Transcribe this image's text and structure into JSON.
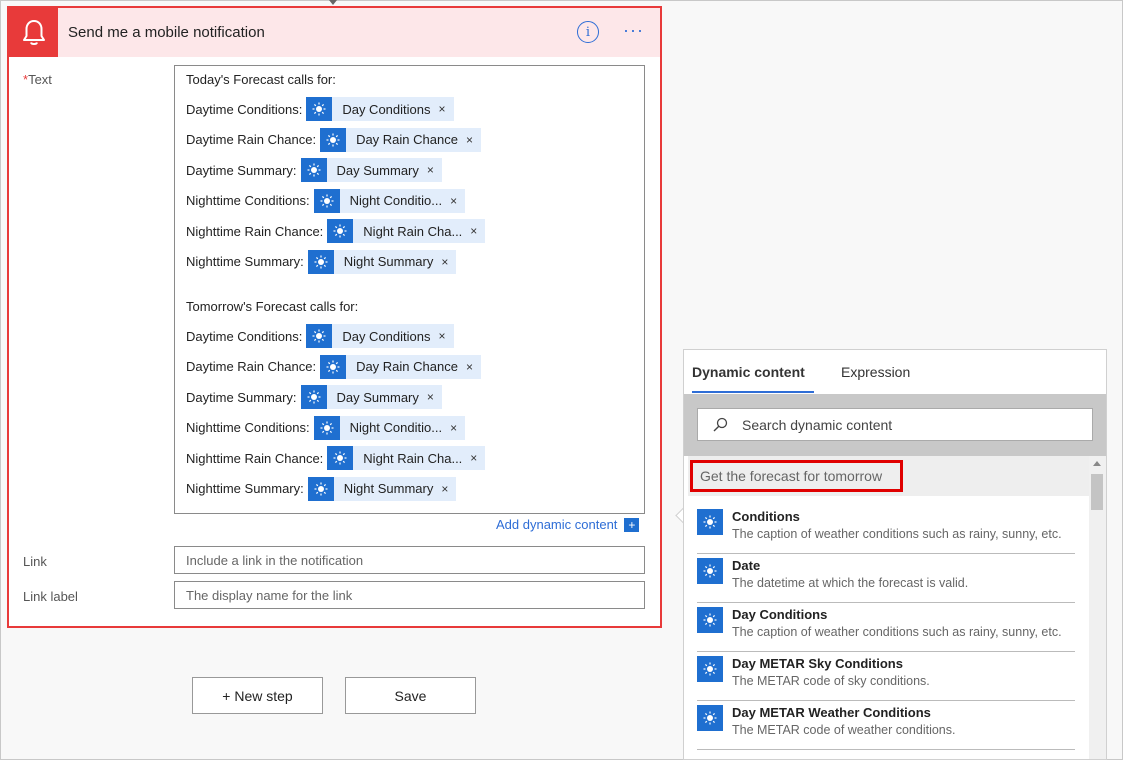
{
  "card": {
    "title": "Send me a mobile notification",
    "info_symbol": "i",
    "more_symbol": "···",
    "text_label": "Text",
    "required_mark": "*",
    "link_label": "Link",
    "link_label_label": "Link label",
    "link_placeholder": "Include a link in the notification",
    "link_label_placeholder": "The display name for the link",
    "add_dynamic_content": "Add dynamic content",
    "add_symbol": "+",
    "body_lines": [
      {
        "text": "Today's Forecast  calls for:"
      },
      {
        "text": "Daytime Conditions:",
        "token": "Day Conditions"
      },
      {
        "text": "Daytime Rain Chance:",
        "token": "Day Rain Chance"
      },
      {
        "text": "Daytime Summary:",
        "token": "Day Summary"
      },
      {
        "text": "Nighttime Conditions:",
        "token": "Night Conditio..."
      },
      {
        "text": "Nighttime Rain Chance:",
        "token": "Night Rain Cha..."
      },
      {
        "text": "Nighttime Summary:",
        "token": "Night Summary"
      },
      {
        "text": ""
      },
      {
        "text": "Tomorrow's Forecast  calls for:"
      },
      {
        "text": "Daytime Conditions:",
        "token": "Day Conditions"
      },
      {
        "text": "Daytime Rain Chance:",
        "token": "Day Rain Chance"
      },
      {
        "text": "Daytime Summary:",
        "token": "Day Summary"
      },
      {
        "text": "Nighttime Conditions:",
        "token": "Night Conditio..."
      },
      {
        "text": "Nighttime Rain Chance:",
        "token": "Night Rain Cha..."
      },
      {
        "text": "Nighttime Summary:",
        "token": "Night Summary"
      }
    ],
    "token_remove": "×"
  },
  "buttons": {
    "new_step": "+ New step",
    "save": "Save"
  },
  "panel": {
    "tabs": [
      "Dynamic content",
      "Expression"
    ],
    "search_placeholder": "Search dynamic content",
    "section_title": "Get the forecast for tomorrow",
    "items": [
      {
        "name": "Conditions",
        "desc": "The caption of weather conditions such as rainy, sunny, etc."
      },
      {
        "name": "Date",
        "desc": "The datetime at which the forecast is valid."
      },
      {
        "name": "Day Conditions",
        "desc": "The caption of weather conditions such as rainy, sunny, etc."
      },
      {
        "name": "Day METAR Sky Conditions",
        "desc": "The METAR code of sky conditions."
      },
      {
        "name": "Day METAR Weather Conditions",
        "desc": "The METAR code of weather conditions."
      }
    ]
  },
  "colors": {
    "accent_red": "#e83a3a",
    "header_bg": "#fde7e9",
    "token_blue": "#1f6fd0",
    "link_blue": "#2e6dd6"
  },
  "icons": {
    "card": "bell-icon",
    "token": "sun-icon",
    "search": "search-icon"
  }
}
